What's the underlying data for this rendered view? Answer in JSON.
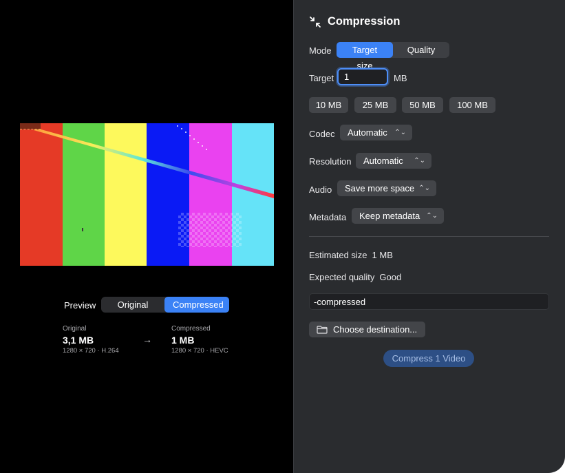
{
  "preview": {
    "label": "Preview",
    "toggle": {
      "options": [
        "Original",
        "Compressed"
      ],
      "selected": "Compressed"
    },
    "bar_colors": [
      "#e53a26",
      "#5fd548",
      "#fdf95c",
      "#0a1af5",
      "#ea42f0",
      "#65e3f8"
    ]
  },
  "original": {
    "caption": "Original",
    "size": "3,1 MB",
    "details": "1280 × 720 · H.264"
  },
  "compressed": {
    "caption": "Compressed",
    "size": "1 MB",
    "details": "1280 × 720 · HEVC"
  },
  "arrow": "→",
  "panel": {
    "title": "Compression",
    "title_icon": "compress-arrows-icon",
    "mode": {
      "label": "Mode",
      "options": [
        "Target size",
        "Quality"
      ],
      "selected": "Target size"
    },
    "target": {
      "label": "Target",
      "value": "1",
      "unit": "MB"
    },
    "presets": [
      "10 MB",
      "25 MB",
      "50 MB",
      "100 MB"
    ],
    "codec": {
      "label": "Codec",
      "value": "Automatic"
    },
    "resolution": {
      "label": "Resolution",
      "value": "Automatic"
    },
    "audio": {
      "label": "Audio",
      "value": "Save more space"
    },
    "metadata": {
      "label": "Metadata",
      "value": "Keep metadata"
    },
    "estimated": {
      "label": "Estimated size",
      "value": "1 MB"
    },
    "quality": {
      "label": "Expected quality",
      "value": "Good"
    },
    "suffix": "-compressed",
    "choose_destination": "Choose destination...",
    "compress_button": "Compress 1 Video"
  },
  "colors": {
    "accent": "#3b82f6",
    "panel_bg": "#2a2c2f",
    "compress_button": "#2d4f85"
  }
}
